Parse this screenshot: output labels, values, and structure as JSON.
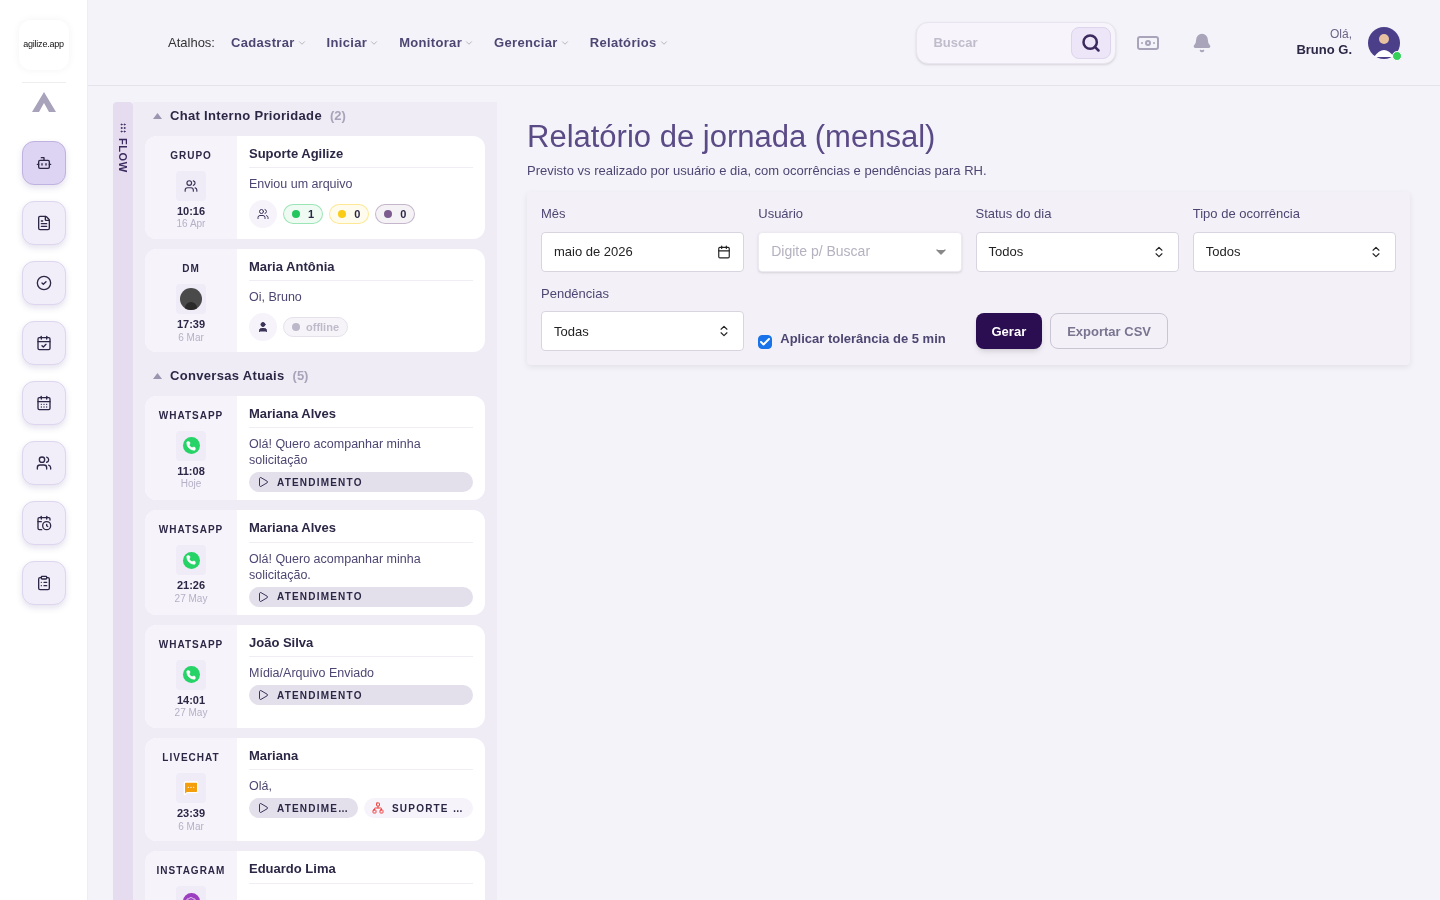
{
  "logo": "agilize.app",
  "nav": {
    "label": "Atalhos:",
    "items": [
      "Cadastrar",
      "Iniciar",
      "Monitorar",
      "Gerenciar",
      "Relatórios"
    ]
  },
  "search": {
    "placeholder": "Buscar"
  },
  "user": {
    "greeting": "Olá,",
    "name": "Bruno G.",
    "online": true
  },
  "sidebar": {
    "items": [
      {
        "selected": true
      },
      {
        "selected": false
      },
      {
        "selected": false
      },
      {
        "selected": false
      },
      {
        "selected": false
      },
      {
        "selected": false
      },
      {
        "selected": false
      },
      {
        "selected": false
      }
    ]
  },
  "flow_tab": "FLOW",
  "groups": [
    {
      "title": "Chat Interno Prioridade",
      "count": "(2)",
      "expanded": true,
      "conversations": [
        {
          "channel": "GRUPO",
          "kind": "group",
          "time": "10:16",
          "date": "16 Apr",
          "name": "Suporte Agilize",
          "message": "Enviou um arquivo",
          "counters": [
            {
              "value": "1",
              "color": "#22c55e"
            },
            {
              "value": "0",
              "color": "#facc15"
            },
            {
              "value": "0",
              "color": "#7c5c8f"
            }
          ]
        },
        {
          "channel": "DM",
          "kind": "dm",
          "time": "17:39",
          "date": "6 Mar",
          "name": "Maria Antônia",
          "message": "Oi, Bruno",
          "status": "offline"
        }
      ]
    },
    {
      "title": "Conversas Atuais",
      "count": "(5)",
      "expanded": true,
      "conversations": [
        {
          "channel": "WHATSAPP",
          "kind": "whatsapp",
          "time": "11:08",
          "date": "Hoje",
          "name": "Mariana Alves",
          "message": "Olá! Quero acompanhar minha solicitação",
          "tags": [
            {
              "label": "ATENDIMENTO",
              "kind": "queue"
            }
          ]
        },
        {
          "channel": "WHATSAPP",
          "kind": "whatsapp",
          "time": "21:26",
          "date": "27 May",
          "name": "Mariana Alves",
          "message": "Olá! Quero acompanhar minha solicitação.",
          "tags": [
            {
              "label": "ATENDIMENTO",
              "kind": "queue"
            }
          ]
        },
        {
          "channel": "WHATSAPP",
          "kind": "whatsapp",
          "time": "14:01",
          "date": "27 May",
          "name": "João Silva",
          "message": "Mídia/Arquivo Enviado",
          "tags": [
            {
              "label": "ATENDIMENTO",
              "kind": "queue"
            }
          ]
        },
        {
          "channel": "LIVECHAT",
          "kind": "livechat",
          "time": "23:39",
          "date": "6 Mar",
          "name": "Mariana",
          "message": "Olá,",
          "tags": [
            {
              "label": "ATENDIME…",
              "kind": "queue"
            },
            {
              "label": "SUPORTE …",
              "kind": "team"
            }
          ]
        },
        {
          "channel": "INSTAGRAM",
          "kind": "instagram",
          "name": "Eduardo Lima"
        }
      ]
    }
  ],
  "report": {
    "title": "Relatório de jornada (mensal)",
    "subtitle": "Previsto vs realizado por usuário e dia, com ocorrências e pendências para RH.",
    "filters": [
      {
        "label": "Mês",
        "kind": "month",
        "value": "maio de 2026"
      },
      {
        "label": "Usuário",
        "kind": "combo",
        "placeholder": "Digite p/ Buscar"
      },
      {
        "label": "Status do dia",
        "kind": "select",
        "value": "Todos"
      },
      {
        "label": "Tipo de ocorrência",
        "kind": "select",
        "value": "Todos"
      },
      {
        "label": "Pendências",
        "kind": "select",
        "value": "Todas"
      }
    ],
    "tolerance": {
      "label": "Aplicar tolerância de 5 min",
      "checked": true
    },
    "buttons": [
      {
        "label": "Gerar",
        "kind": "primary"
      },
      {
        "label": "Exportar CSV",
        "kind": "secondary"
      }
    ]
  }
}
